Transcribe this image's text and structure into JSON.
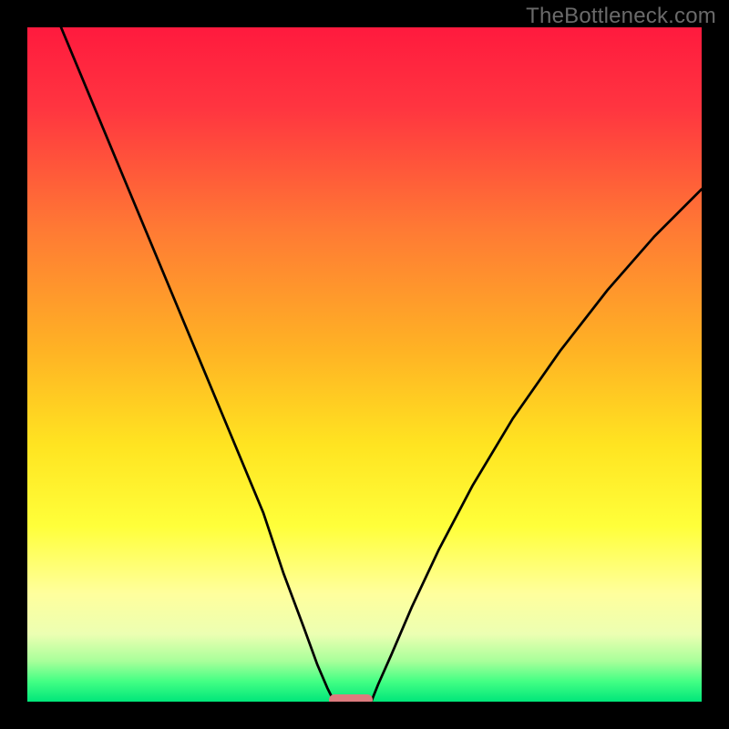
{
  "watermark": "TheBottleneck.com",
  "chart_data": {
    "type": "line",
    "title": "",
    "xlabel": "",
    "ylabel": "",
    "xlim": [
      0,
      100
    ],
    "ylim": [
      0,
      100
    ],
    "grid": false,
    "background_gradient": {
      "stops": [
        {
          "pos": 0.0,
          "color": "#ff1a3e"
        },
        {
          "pos": 0.12,
          "color": "#ff3540"
        },
        {
          "pos": 0.3,
          "color": "#ff7a34"
        },
        {
          "pos": 0.48,
          "color": "#ffb324"
        },
        {
          "pos": 0.62,
          "color": "#ffe421"
        },
        {
          "pos": 0.74,
          "color": "#ffff3a"
        },
        {
          "pos": 0.84,
          "color": "#ffff9d"
        },
        {
          "pos": 0.9,
          "color": "#ecffb2"
        },
        {
          "pos": 0.94,
          "color": "#a8ff9a"
        },
        {
          "pos": 0.97,
          "color": "#43ff84"
        },
        {
          "pos": 1.0,
          "color": "#00e67a"
        }
      ]
    },
    "series": [
      {
        "name": "left-curve",
        "x": [
          5,
          10,
          15,
          20,
          25,
          30,
          35,
          38,
          41,
          43,
          44.5,
          45.5
        ],
        "y": [
          100,
          88,
          76,
          64,
          52,
          40,
          28,
          19,
          11,
          5.5,
          2,
          0
        ]
      },
      {
        "name": "right-curve",
        "x": [
          51,
          52,
          54,
          57,
          61,
          66,
          72,
          79,
          86,
          93,
          100
        ],
        "y": [
          0,
          2.5,
          7,
          14,
          22.5,
          32,
          42,
          52,
          61,
          69,
          76
        ]
      }
    ],
    "marker": {
      "x_center": 48,
      "width_pct": 6.5,
      "color": "#dd7b7e"
    }
  }
}
